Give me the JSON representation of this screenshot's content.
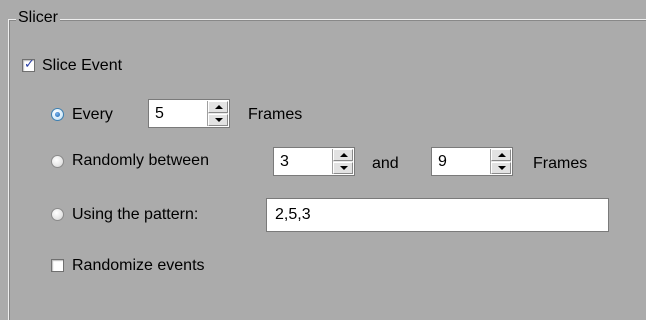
{
  "group": {
    "title": "Slicer"
  },
  "slice_event": {
    "label": "Slice Event",
    "checked": true
  },
  "every": {
    "label": "Every",
    "value": "5",
    "unit": "Frames",
    "selected": true
  },
  "randomly": {
    "label": "Randomly between",
    "min": "3",
    "and_label": "and",
    "max": "9",
    "unit": "Frames",
    "selected": false
  },
  "pattern": {
    "label": "Using the pattern:",
    "value": "2,5,3",
    "selected": false
  },
  "randomize": {
    "label": "Randomize events",
    "checked": false
  },
  "icons": {
    "check": "checkmark-icon",
    "spin_up": "chevron-up-icon",
    "spin_down": "chevron-down-icon"
  },
  "colors": {
    "background": "#ababab",
    "check": "#2a3fa6",
    "radio_accent": "#1b5fa8"
  }
}
